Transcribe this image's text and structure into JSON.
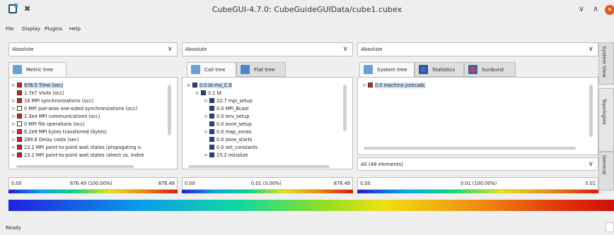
{
  "window": {
    "title": "CubeGUI-4.7.0: CubeGuideGUIData/cube1.cubex",
    "minimize": "∨",
    "maximize": "∧",
    "close": "×"
  },
  "menu": [
    "File",
    "Display",
    "Plugins",
    "Help"
  ],
  "panels": [
    {
      "mode": "Absolute",
      "tabs": [
        {
          "label": "Metric tree",
          "icon": "metric-tree-icon"
        }
      ],
      "rows": [
        {
          "chev": ">",
          "color": "#d42020",
          "text": "876.5 Time (sec)",
          "selected": true
        },
        {
          "chev": "",
          "color": "#d42020",
          "text": "1.7e7 Visits (occ)",
          "selected": false
        },
        {
          "chev": ">",
          "color": "#d42020",
          "text": "16 MPI synchronizations (occ)",
          "selected": false
        },
        {
          "chev": ">",
          "color": "#ffffff",
          "text": "0 MPI pair-wise one-sided synchronizations (occ)",
          "selected": false
        },
        {
          "chev": ">",
          "color": "#d42020",
          "text": "2.3e4 MPI communications (occ)",
          "selected": false
        },
        {
          "chev": ">",
          "color": "#ffffff",
          "text": "0 MPI file operations (occ)",
          "selected": false
        },
        {
          "chev": ">",
          "color": "#d42020",
          "text": "6.2e9 MPI bytes transferred (bytes)",
          "selected": false
        },
        {
          "chev": ">",
          "color": "#d42020",
          "text": "269.6 Delay costs (sec)",
          "selected": false
        },
        {
          "chev": ">",
          "color": "#d42020",
          "text": "23.2 MPI point-to-point wait states (propagating v:",
          "selected": false
        },
        {
          "chev": ">",
          "color": "#d42020",
          "text": "23.2 MPI point-to-point wait states (direct vs. indire",
          "selected": false
        }
      ],
      "value": {
        "min": "0.00",
        "mid": "876.49 (100.00%)",
        "max": "876.49"
      }
    },
    {
      "mode": "Absolute",
      "tabs": [
        {
          "label": "Call tree",
          "icon": "call-tree-icon"
        },
        {
          "label": "Flat tree",
          "icon": "flat-tree-icon"
        }
      ],
      "rows": [
        {
          "chev": "∨",
          "indent": 0,
          "color": "#1d3fb0",
          "text": "0.0 bt-mz_C.8",
          "selected": true
        },
        {
          "chev": "∨",
          "indent": 1,
          "color": "#1d3fb0",
          "text": "0.1 bt",
          "selected": false
        },
        {
          "chev": ">",
          "indent": 2,
          "color": "#1d3fb0",
          "text": "22.7 mpi_setup",
          "selected": false
        },
        {
          "chev": "",
          "indent": 2,
          "color": "#1d3fb0",
          "text": "0.0 MPI_Bcast",
          "selected": false
        },
        {
          "chev": ">",
          "indent": 2,
          "color": "#1d3fb0",
          "text": "0.0 env_setup",
          "selected": false
        },
        {
          "chev": "",
          "indent": 2,
          "color": "#1d3fb0",
          "text": "0.0 zone_setup",
          "selected": false
        },
        {
          "chev": ">",
          "indent": 2,
          "color": "#1d3fb0",
          "text": "0.0 map_zones",
          "selected": false
        },
        {
          "chev": "",
          "indent": 2,
          "color": "#1d3fb0",
          "text": "0.0 zone_starts",
          "selected": false
        },
        {
          "chev": "",
          "indent": 2,
          "color": "#1d3fb0",
          "text": "0.0 set_constants",
          "selected": false
        },
        {
          "chev": ">",
          "indent": 2,
          "color": "#1d3fb0",
          "text": "15.2 initialize",
          "selected": false
        }
      ],
      "value": {
        "min": "0.00",
        "mid": "0.01 (0.00%)",
        "max": "876.49"
      }
    },
    {
      "mode": "Absolute",
      "tabs": [
        {
          "label": "System tree",
          "icon": "system-tree-icon"
        },
        {
          "label": "Statistics",
          "icon": "statistics-icon"
        },
        {
          "label": "Sunburst",
          "icon": "sunburst-icon"
        }
      ],
      "rows": [
        {
          "chev": ">",
          "indent": 0,
          "color": "#d42020",
          "text": "0.0 machine jurecadc",
          "selected": true
        }
      ],
      "filter": "All (48 elements)",
      "value": {
        "min": "0.00",
        "mid": "0.01 (100.00%)",
        "max": "0.01"
      }
    }
  ],
  "sidebar": [
    "System View",
    "Topologies",
    "General"
  ],
  "status": "Ready"
}
